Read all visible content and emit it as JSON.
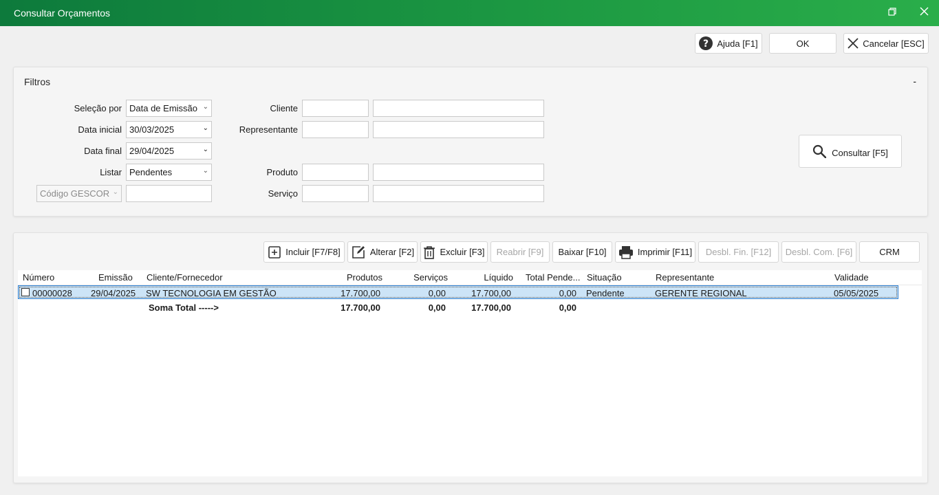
{
  "window": {
    "title": "Consultar Orçamentos"
  },
  "top_buttons": {
    "help": "Ajuda [F1]",
    "ok": "OK",
    "cancel": "Cancelar [ESC]"
  },
  "filters": {
    "title": "Filtros",
    "collapse": "-",
    "selecao_label": "Seleção por",
    "selecao_value": "Data de Emissão",
    "data_inicial_label": "Data inicial",
    "data_inicial_value": "30/03/2025",
    "data_final_label": "Data final",
    "data_final_value": "29/04/2025",
    "listar_label": "Listar",
    "listar_value": "Pendentes",
    "codigo_value": "Código GESCOR",
    "codigo_input": "",
    "cliente_label": "Cliente",
    "cliente_code": "",
    "cliente_name": "",
    "representante_label": "Representante",
    "representante_code": "",
    "representante_name": "",
    "produto_label": "Produto",
    "produto_code": "",
    "produto_name": "",
    "servico_label": "Serviço",
    "servico_code": "",
    "servico_name": "",
    "consultar": "Consultar [F5]"
  },
  "toolbar": {
    "incluir": "Incluir [F7/F8]",
    "alterar": "Alterar [F2]",
    "excluir": "Excluir [F3]",
    "reabrir": "Reabrir [F9]",
    "baixar": "Baixar [F10]",
    "imprimir": "Imprimir [F11]",
    "desbl_fin": "Desbl. Fin. [F12]",
    "desbl_com": "Desbl. Com. [F6]",
    "crm": "CRM"
  },
  "grid": {
    "columns": [
      "Número",
      "Emissão",
      "Cliente/Fornecedor",
      "Produtos",
      "Serviços",
      "Líquido",
      "Total Pende...",
      "Situação",
      "Representante",
      "Validade"
    ],
    "rows": [
      {
        "numero": "00000028",
        "emissao": "29/04/2025",
        "cliente": "SW TECNOLOGIA EM GESTÃO",
        "produtos": "17.700,00",
        "servicos": "0,00",
        "liquido": "17.700,00",
        "total_pendente": "0,00",
        "situacao": "Pendente",
        "representante": "GERENTE REGIONAL",
        "validade": "05/05/2025"
      }
    ],
    "totals": {
      "label": "Soma Total ----->",
      "produtos": "17.700,00",
      "servicos": "0,00",
      "liquido": "17.700,00",
      "total_pendente": "0,00"
    }
  }
}
